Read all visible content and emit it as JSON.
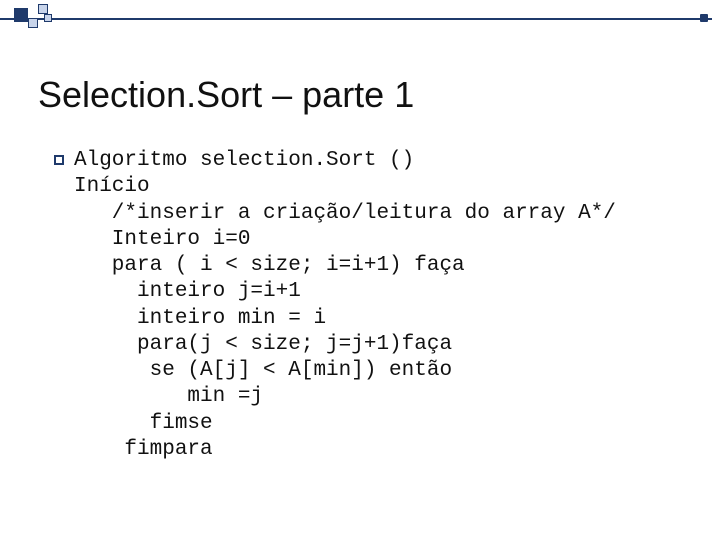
{
  "slide": {
    "title": "Selection.Sort – parte 1",
    "code": {
      "line1": "Algoritmo selection.Sort ()",
      "line2": "Início",
      "line3": "   /*inserir a criação/leitura do array A*/",
      "line4": "   Inteiro i=0",
      "line5": "   para ( i < size; i=i+1) faça",
      "line6": "     inteiro j=i+1",
      "line7": "     inteiro min = i",
      "line8": "     para(j < size; j=j+1)faça",
      "line9": "      se (A[j] < A[min]) então",
      "line10": "         min =j",
      "line11": "      fimse",
      "line12": "    fimpara"
    }
  }
}
